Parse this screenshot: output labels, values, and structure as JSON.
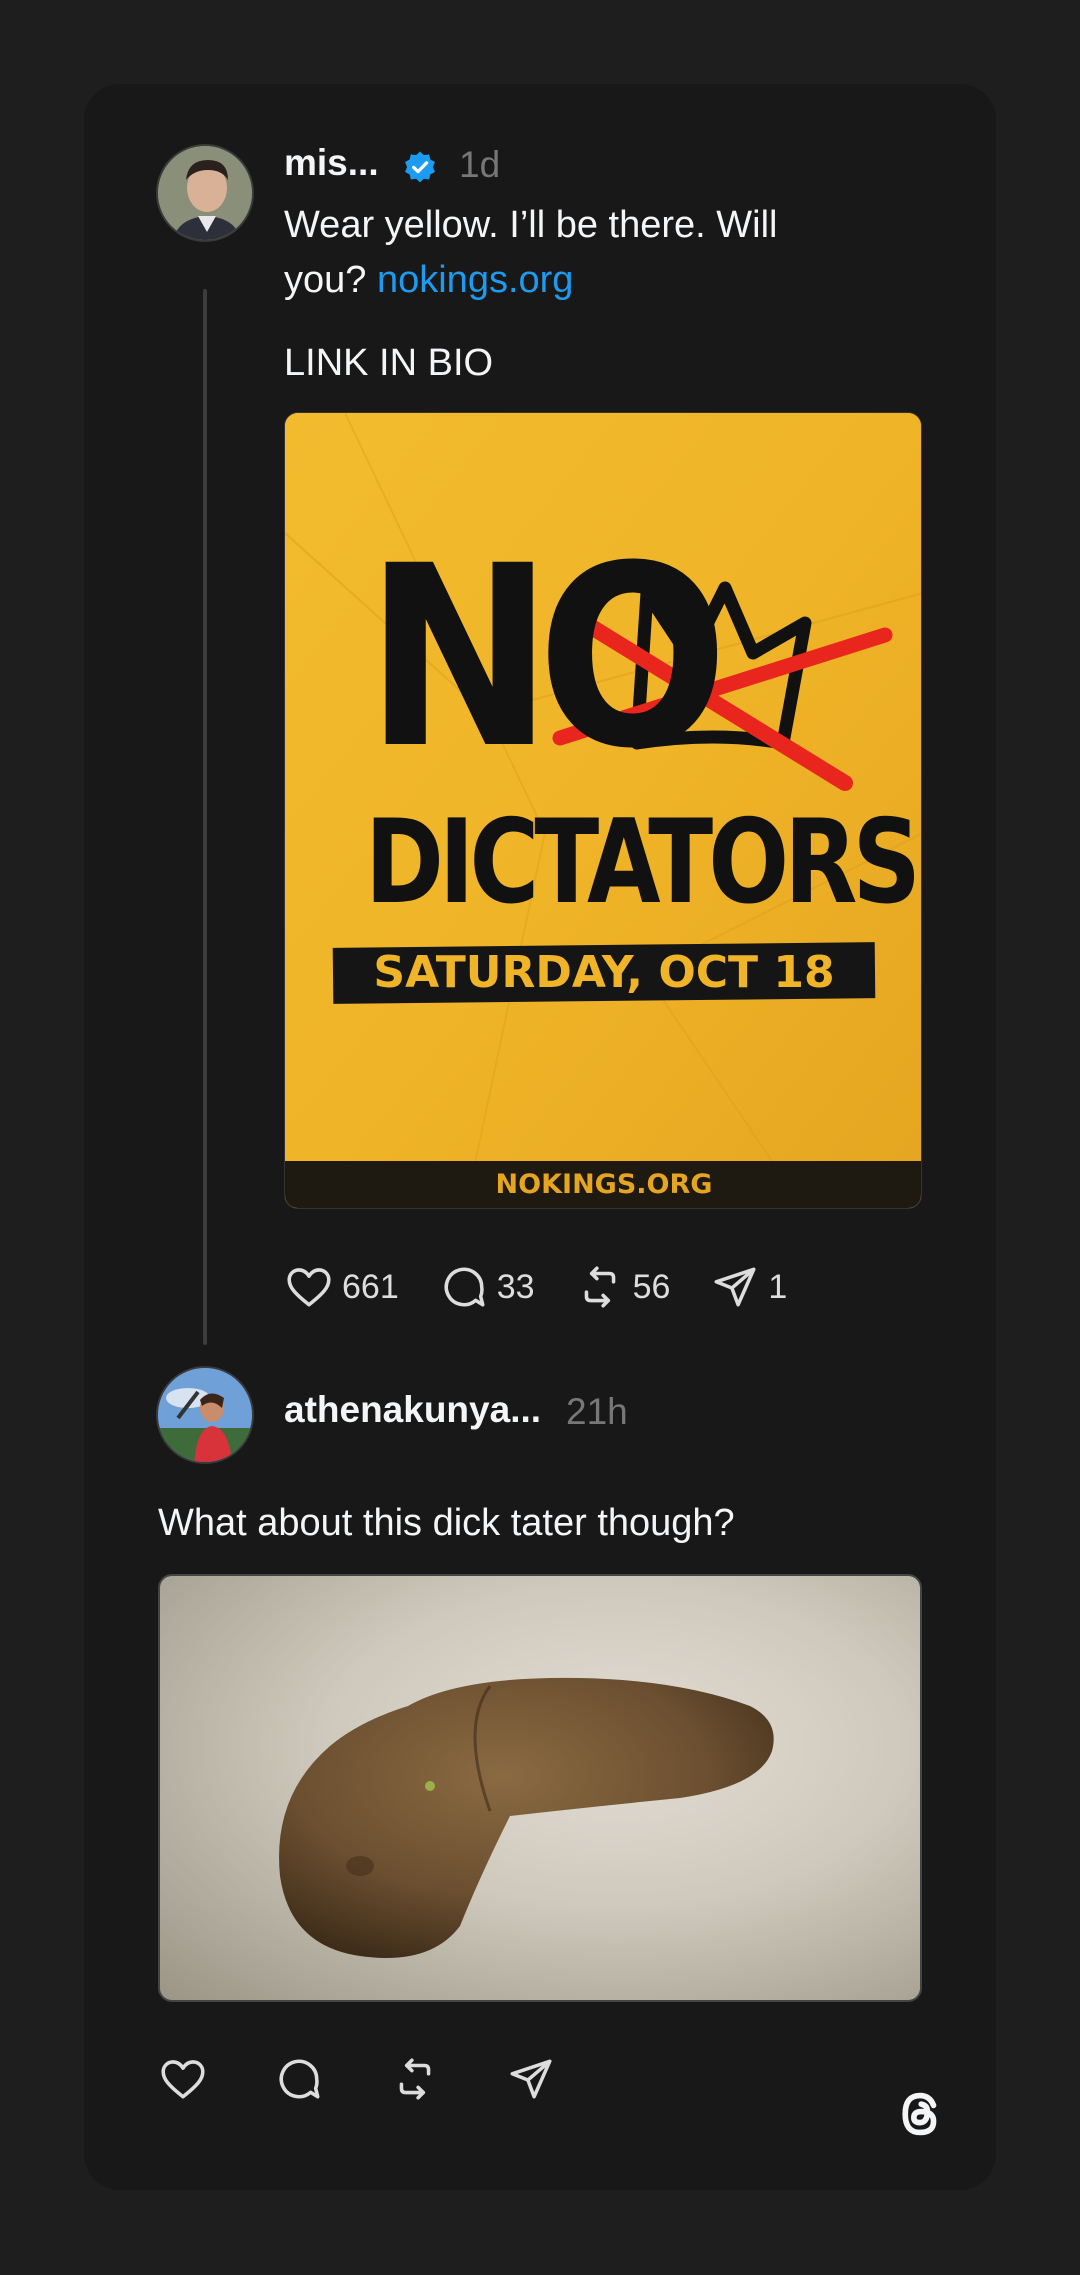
{
  "post1": {
    "username": "mis...",
    "time": "1d",
    "text_line1": "Wear yellow. I’ll be there. Will",
    "text_line2_prefix": "you?",
    "link": "nokings.org",
    "text2": "LINK IN BIO",
    "poster": {
      "word_no": "NO",
      "word_dictators": "DICTATORS",
      "date": "SATURDAY, OCT 18",
      "footer": "NOKINGS.ORG"
    },
    "likes": "661",
    "replies": "33",
    "reposts": "56",
    "shares": "1"
  },
  "post2": {
    "username": "athenakunya...",
    "time": "21h",
    "text": "What about this dick tater though?"
  },
  "colors": {
    "background": "#1e1e1e",
    "card": "#181818",
    "link": "#1d9bf0",
    "poster_yellow": "#f0b428",
    "poster_red": "#e8261e"
  },
  "icons": [
    "heart-icon",
    "reply-icon",
    "repost-icon",
    "share-icon",
    "verified-badge-icon",
    "threads-logo-icon"
  ]
}
